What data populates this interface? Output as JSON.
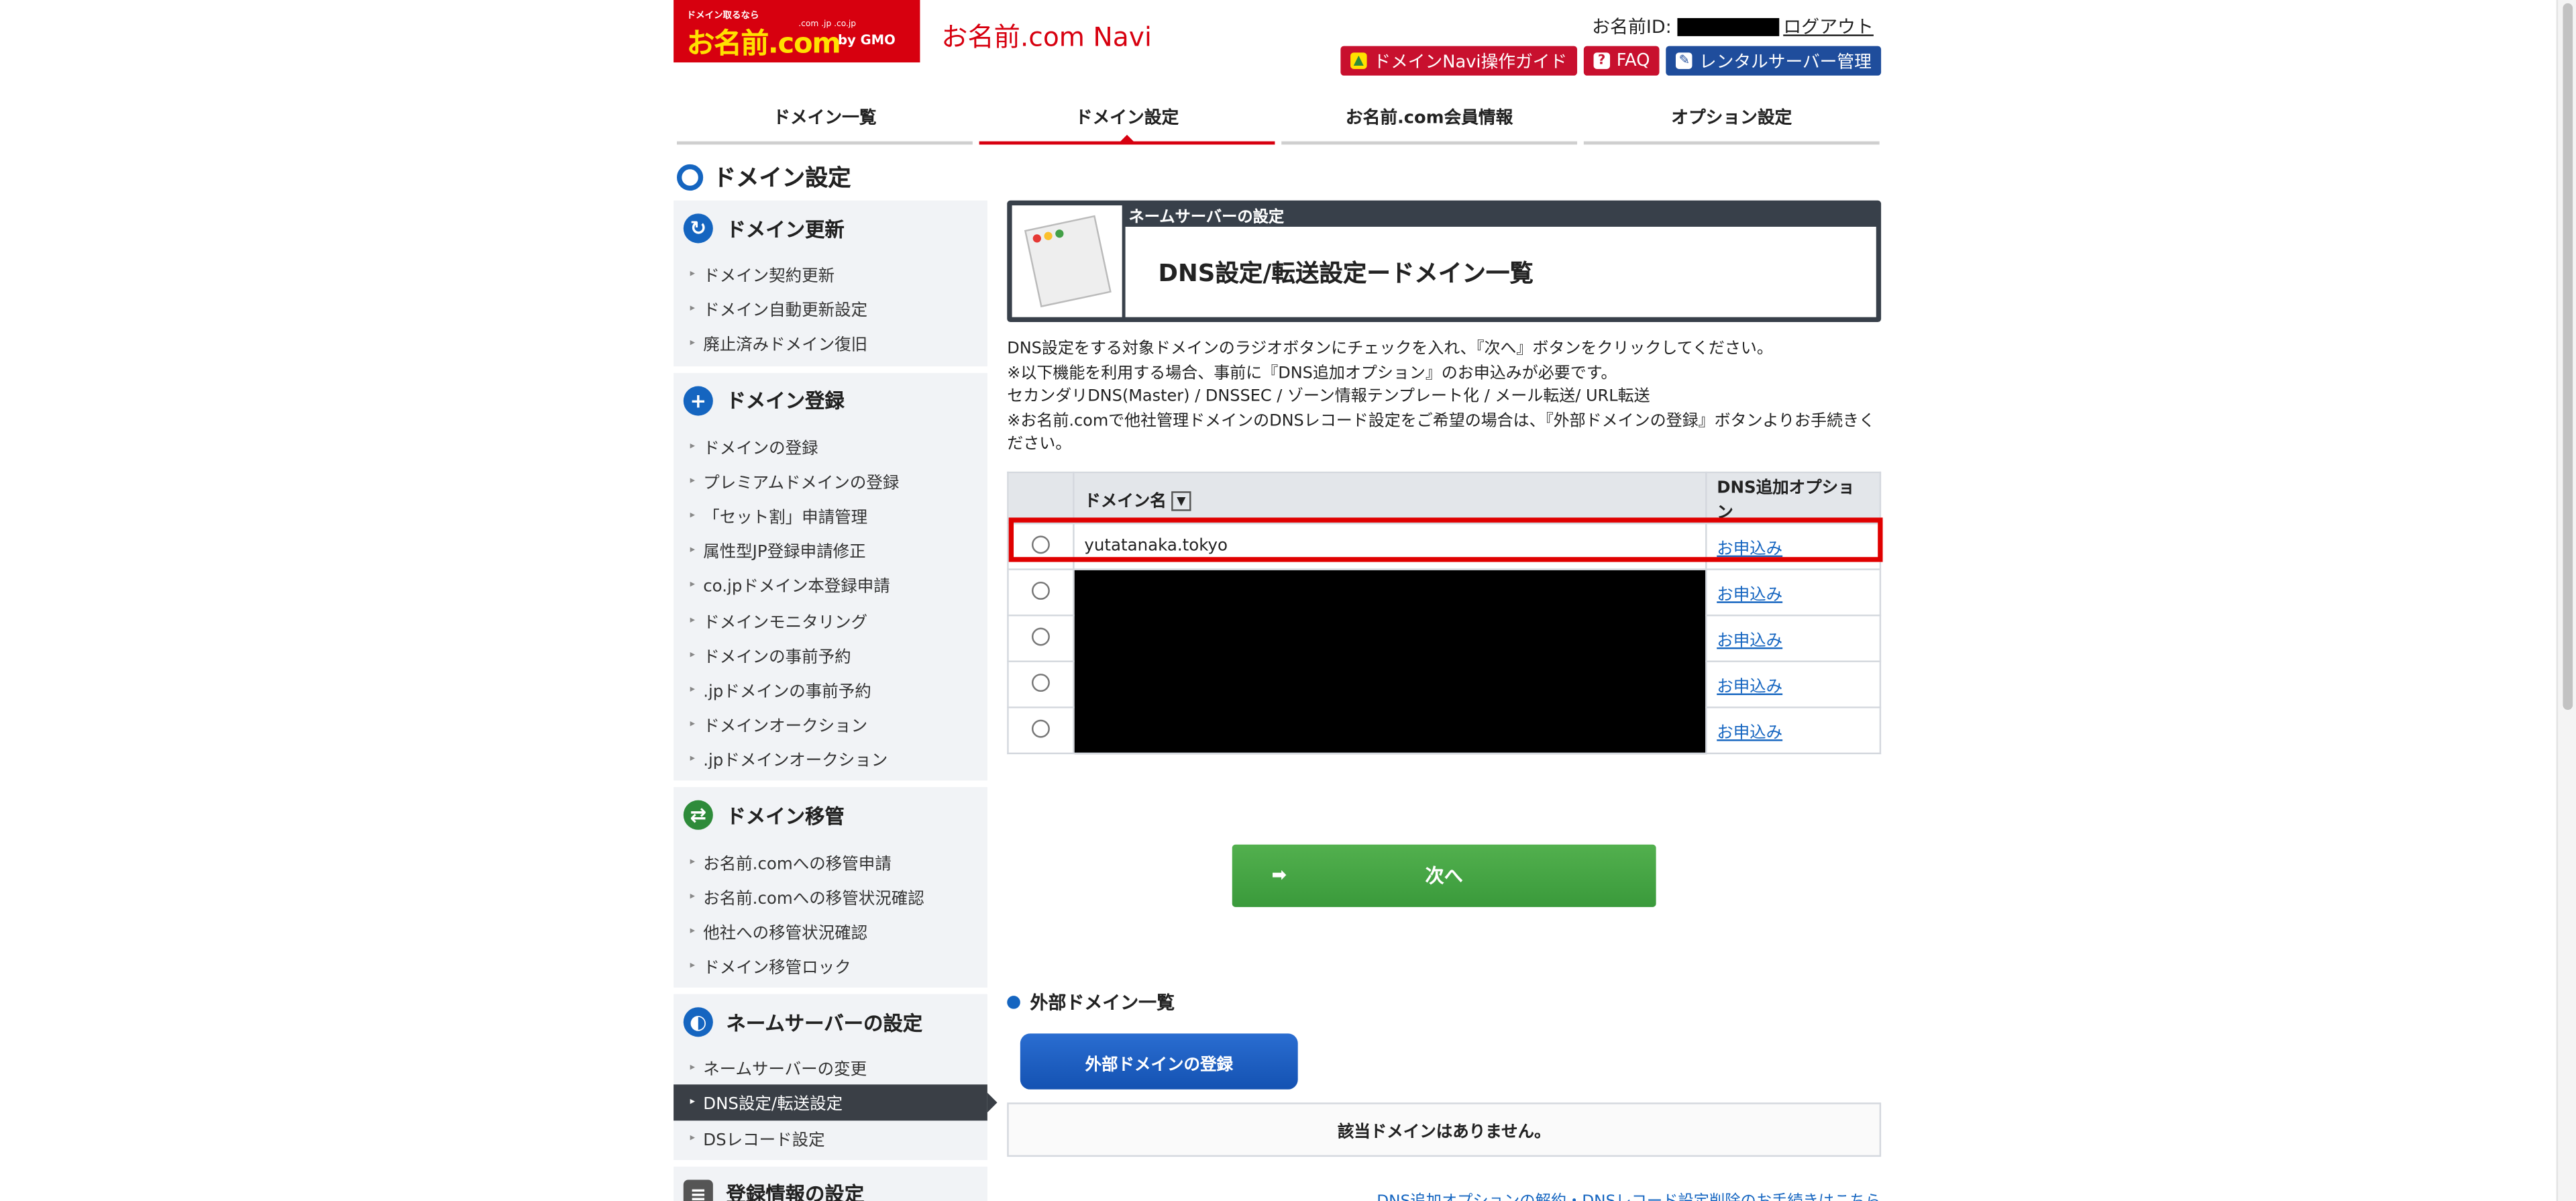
{
  "header": {
    "logo_sub": "ドメイン取るなら",
    "logo_tlds": ".com .jp .co.jp",
    "logo_main": "お名前.com",
    "logo_gmo": "by GMO",
    "navi_title": "お名前.com Navi",
    "member_label": "お名前ID:",
    "logout": "ログアウト",
    "buttons": [
      {
        "label": "ドメインNavi操作ガイド",
        "icon": "beginner-leaf-icon",
        "color": "#c8102e"
      },
      {
        "label": "FAQ",
        "icon": "question-icon",
        "color": "#c8102e"
      },
      {
        "label": "レンタルサーバー管理",
        "icon": "wrench-icon",
        "color": "#1f4d9c"
      }
    ]
  },
  "tabs": [
    {
      "label": "ドメイン一覧",
      "active": false
    },
    {
      "label": "ドメイン設定",
      "active": true
    },
    {
      "label": "お名前.com会員情報",
      "active": false
    },
    {
      "label": "オプション設定",
      "active": false
    }
  ],
  "page_title": "ドメイン設定",
  "sidebar": {
    "sections": [
      {
        "title": "ドメイン更新",
        "icon": "refresh-globe-icon",
        "color": "#1565c0",
        "items": [
          "ドメイン契約更新",
          "ドメイン自動更新設定",
          "廃止済みドメイン復旧"
        ]
      },
      {
        "title": "ドメイン登録",
        "icon": "plus-globe-icon",
        "color": "#1565c0",
        "items": [
          "ドメインの登録",
          "プレミアムドメインの登録",
          "「セット割」申請管理",
          "属性型JP登録申請修正",
          "co.jpドメイン本登録申請",
          "ドメインモニタリング",
          "ドメインの事前予約",
          ".jpドメインの事前予約",
          "ドメインオークション",
          ".jpドメインオークション"
        ]
      },
      {
        "title": "ドメイン移管",
        "icon": "transfer-globe-icon",
        "color": "#2e8b3a",
        "items": [
          "お名前.comへの移管申請",
          "お名前.comへの移管状況確認",
          "他社への移管状況確認",
          "ドメイン移管ロック"
        ]
      },
      {
        "title": "ネームサーバーの設定",
        "icon": "nameserver-globe-icon",
        "color": "#1565c0",
        "items": [
          "ネームサーバーの変更",
          "DNS設定/転送設定",
          "DSレコード設定"
        ],
        "active_item": "DNS設定/転送設定"
      },
      {
        "title": "登録情報の設定",
        "icon": "registration-info-icon",
        "color": "#555555",
        "items": []
      }
    ]
  },
  "content": {
    "sublabel": "ネームサーバーの設定",
    "title": "DNS設定/転送設定ードメイン一覧",
    "desc": [
      "DNS設定をする対象ドメインのラジオボタンにチェックを入れ、『次へ』ボタンをクリックしてください。",
      "※以下機能を利用する場合、事前に『DNS追加オプション』のお申込みが必要です。",
      "セカンダリDNS(Master) / DNSSEC / ゾーン情報テンプレート化 / メール転送/ URL転送",
      "※お名前.comで他社管理ドメインのDNSレコード設定をご希望の場合は、『外部ドメインの登録』ボタンよりお手続きください。"
    ],
    "table": {
      "col_domain": "ドメイン名",
      "col_option": "DNS追加オプション",
      "apply_label": "お申込み",
      "rows": [
        {
          "domain": "yutatanaka.tokyo"
        },
        {
          "domain": ""
        },
        {
          "domain": ""
        },
        {
          "domain": ""
        },
        {
          "domain": ""
        }
      ]
    },
    "next_label": "次へ",
    "ext_heading": "外部ドメイン一覧",
    "ext_button": "外部ドメインの登録",
    "no_domain": "該当ドメインはありません。",
    "footer_link": "DNS追加オプションの解約・DNSレコード設定削除のお手続きはこちら"
  }
}
